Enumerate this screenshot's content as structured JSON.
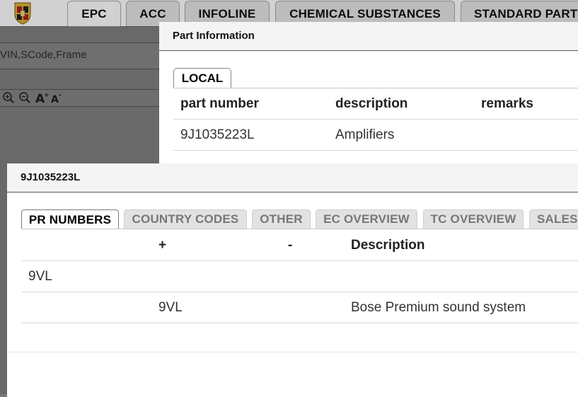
{
  "app": {
    "main_tabs": [
      {
        "label": "EPC",
        "active": true
      },
      {
        "label": "ACC",
        "active": false
      },
      {
        "label": "INFOLINE",
        "active": false
      },
      {
        "label": "CHEMICAL SUBSTANCES",
        "active": false
      },
      {
        "label": "STANDARD PARTS",
        "active": false
      }
    ],
    "search": {
      "placeholder": "VIN,SCode,Frame"
    },
    "zoom_controls": [
      "zoom-in-icon",
      "zoom-out-icon",
      "font-increase-icon",
      "font-decrease-icon"
    ]
  },
  "part_info_dialog": {
    "title": "Part Information",
    "tab": "LOCAL",
    "columns": [
      "part number",
      "description",
      "remarks"
    ],
    "rows": [
      {
        "part_number": "9J1035223L",
        "description": "Amplifiers",
        "remarks": ""
      }
    ]
  },
  "detail_dialog": {
    "title": "9J1035223L",
    "tabs": [
      {
        "label": "PR NUMBERS",
        "active": true
      },
      {
        "label": "COUNTRY CODES",
        "active": false
      },
      {
        "label": "OTHER",
        "active": false
      },
      {
        "label": "EC OVERVIEW",
        "active": false
      },
      {
        "label": "TC OVERVIEW",
        "active": false
      },
      {
        "label": "SALES",
        "active": false
      }
    ],
    "columns": [
      "",
      "+",
      "-",
      "Description"
    ],
    "rows": [
      {
        "code": "9VL",
        "plus": "",
        "minus": "",
        "description": ""
      },
      {
        "code": "",
        "plus": "9VL",
        "minus": "",
        "description": "Bose Premium sound system"
      }
    ]
  },
  "colors": {
    "overlay": "#000000",
    "header_bg": "#f4f4f4",
    "inactive_tab": "#e2e2e2"
  }
}
